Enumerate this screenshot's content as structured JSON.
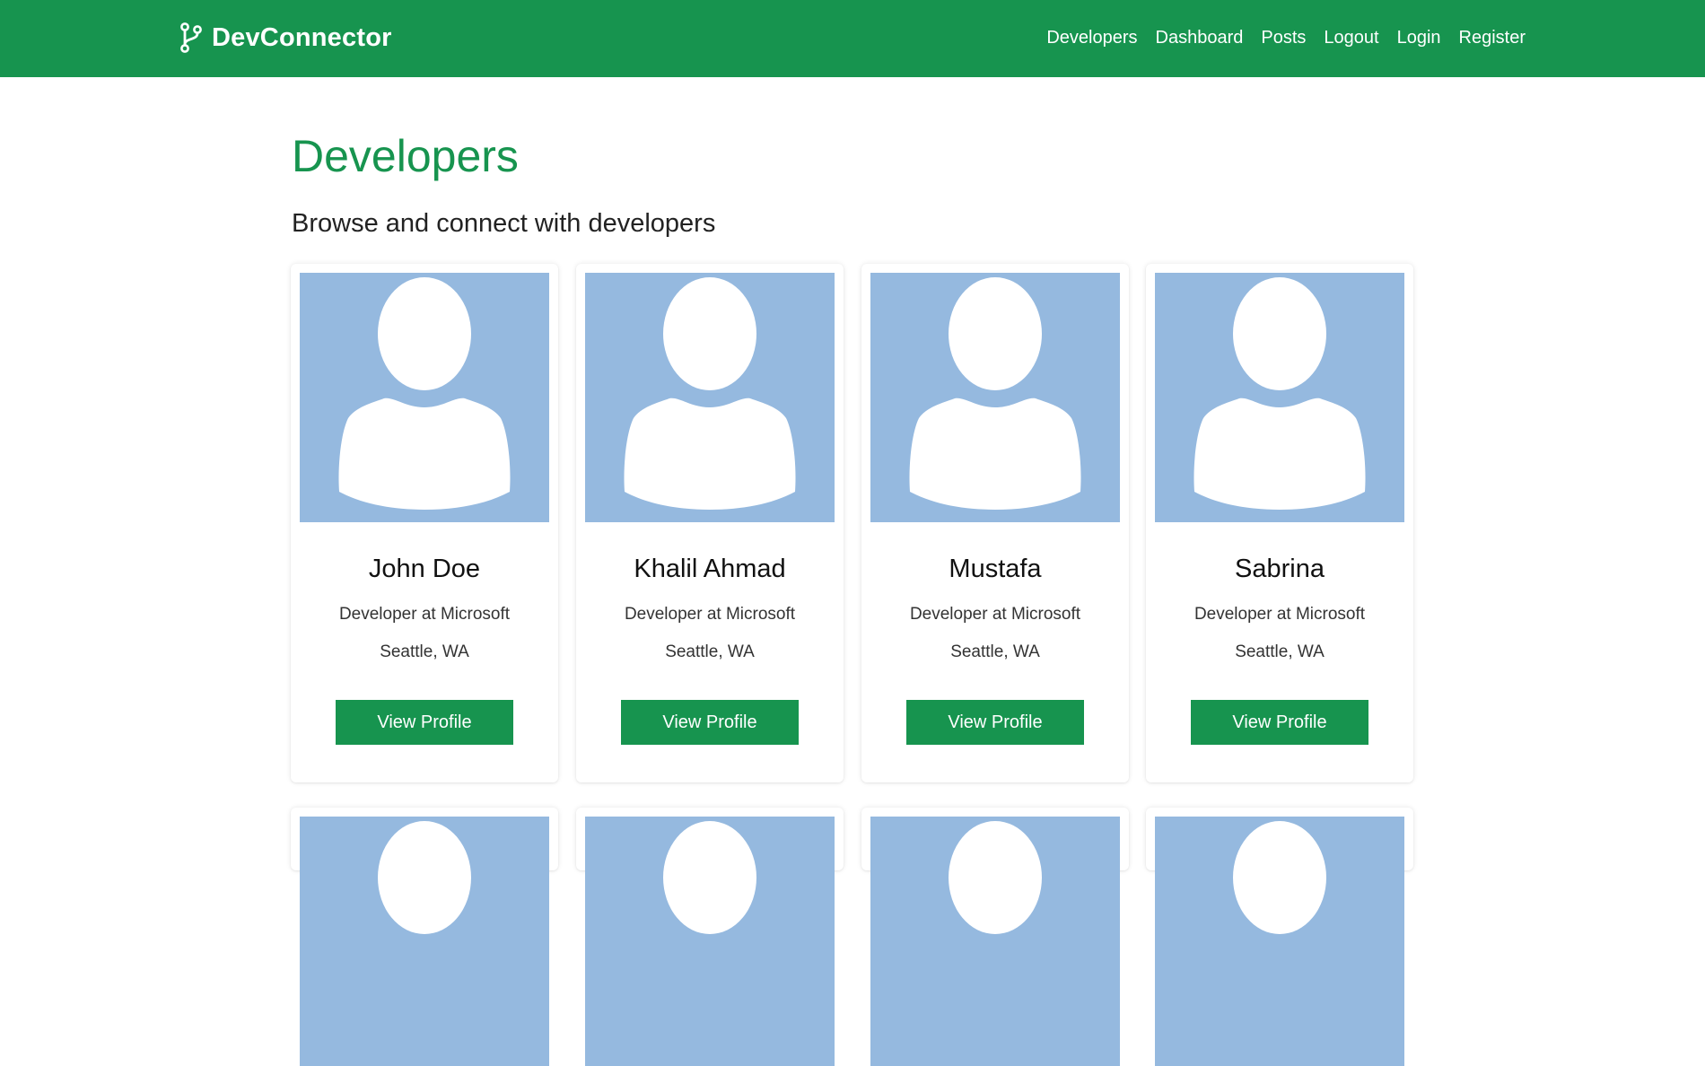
{
  "navbar": {
    "brand": "DevConnector",
    "brand_icon": "code-branch-icon",
    "links": [
      "Developers",
      "Dashboard",
      "Posts",
      "Logout",
      "Login",
      "Register"
    ]
  },
  "main": {
    "title": "Developers",
    "lead": "Browse and connect with developers"
  },
  "profiles": [
    {
      "name": "John Doe",
      "status": "Developer at Microsoft",
      "location": "Seattle, WA",
      "button": "View Profile"
    },
    {
      "name": "Khalil Ahmad",
      "status": "Developer at Microsoft",
      "location": "Seattle, WA",
      "button": "View Profile"
    },
    {
      "name": "Mustafa",
      "status": "Developer at Microsoft",
      "location": "Seattle, WA",
      "button": "View Profile"
    },
    {
      "name": "Sabrina",
      "status": "Developer at Microsoft",
      "location": "Seattle, WA",
      "button": "View Profile"
    }
  ],
  "colors": {
    "primary": "#17944f",
    "avatar_bg": "#95b9df",
    "avatar_fg": "#ffffff"
  }
}
